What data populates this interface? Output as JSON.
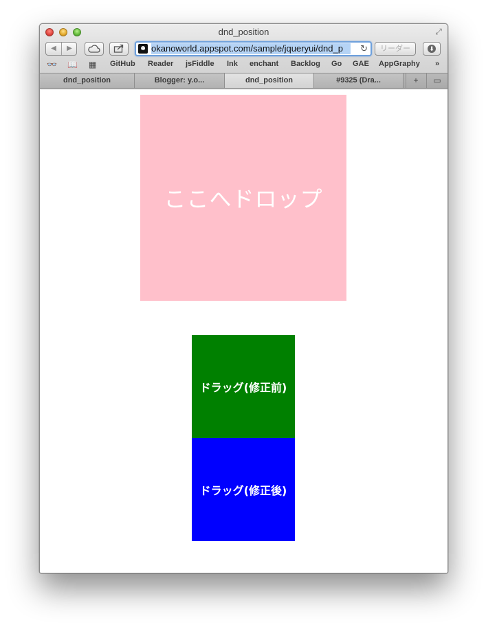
{
  "window": {
    "title": "dnd_position"
  },
  "toolbar": {
    "url": "okanoworld.appspot.com/sample/jqueryui/dnd_p",
    "reader_label": "リーダー"
  },
  "bookmarks": [
    "GitHub",
    "Reader",
    "jsFiddle",
    "Ink",
    "enchant",
    "Backlog",
    "Go",
    "GAE",
    "AppGraphy"
  ],
  "tabs": [
    {
      "label": "dnd_position",
      "active": false
    },
    {
      "label": "Blogger: y.o...",
      "active": false
    },
    {
      "label": "dnd_position",
      "active": true
    },
    {
      "label": "#9325 (Dra...",
      "active": false
    }
  ],
  "page": {
    "dropzone_text": "ここへドロップ",
    "drag_before_text": "ドラッグ(修正前)",
    "drag_after_text": "ドラッグ(修正後)"
  },
  "colors": {
    "dropzone": "#ffc0cb",
    "drag_before": "#008000",
    "drag_after": "#0000ff"
  }
}
